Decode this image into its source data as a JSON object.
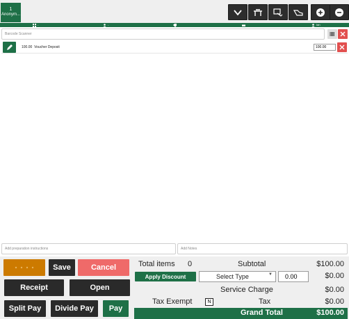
{
  "order_tab": {
    "number": "1",
    "name": "Anonym..."
  },
  "toolbar": {
    "buttons": [
      {
        "name": "chevron-down-icon"
      },
      {
        "name": "dine-in-icon"
      },
      {
        "name": "payment-terminal-icon"
      },
      {
        "name": "hand-service-icon"
      },
      {
        "name": "plus-icon"
      },
      {
        "name": "minus-icon"
      }
    ]
  },
  "greenbar": {
    "table": "-",
    "guests": "-",
    "tag": "",
    "delivery": "",
    "user": "Ian"
  },
  "barcode": {
    "placeholder": "Barcode Scanner"
  },
  "items": [
    {
      "qty_price": "100.00",
      "name": "Voucher Deposit",
      "price": "100.00"
    }
  ],
  "notes": {
    "prep_placeholder": "Add preparation instructions",
    "notes_placeholder": "Add Notes"
  },
  "actions": {
    "save": "Save",
    "cancel": "Cancel",
    "receipt": "Receipt",
    "open": "Open",
    "split_pay": "Split Pay",
    "divide_pay": "Divide Pay",
    "pay": "Pay"
  },
  "totals": {
    "total_items_label": "Total items",
    "total_items": "0",
    "subtotal_label": "Subtotal",
    "subtotal": "$100.00",
    "apply_discount": "Apply Discount",
    "select_type": "Select Type",
    "discount_value": "0.00",
    "discount_amount": "$0.00",
    "service_charge_label": "Service Charge",
    "service_charge": "$0.00",
    "tax_exempt_label": "Tax Exempt",
    "tax_exempt_value": "N",
    "tax_label": "Tax",
    "tax": "$0.00",
    "grand_total_label": "Grand Total",
    "grand_total": "$100.00"
  },
  "colors": {
    "brand_green": "#1e7047",
    "danger_red": "#e2504f",
    "dark_button": "#2a2a2a",
    "orange": "#cc7a00",
    "cancel_salmon": "#ef6a69"
  }
}
